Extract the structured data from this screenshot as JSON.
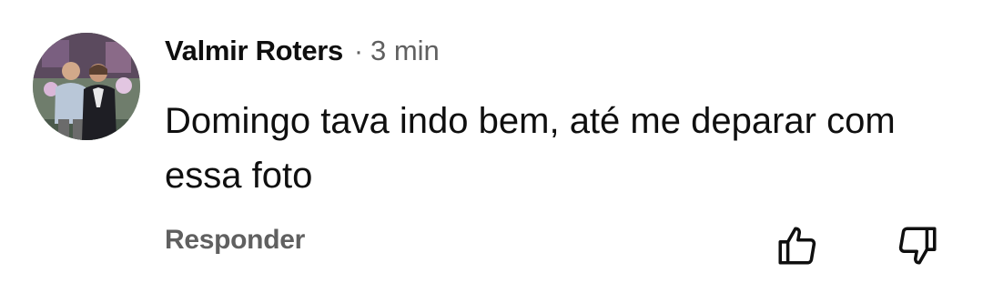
{
  "comment": {
    "author": "Valmir Roters",
    "separator": "·",
    "time": "3 min",
    "text": "Domingo tava indo bem, até me deparar com essa foto",
    "reply_label": "Responder"
  },
  "icons": {
    "avatar": "avatar-photo",
    "like": "thumbs-up-icon",
    "dislike": "thumbs-down-icon"
  },
  "colors": {
    "primary_text": "#0f0f0f",
    "secondary_text": "#606060",
    "background": "#ffffff"
  }
}
